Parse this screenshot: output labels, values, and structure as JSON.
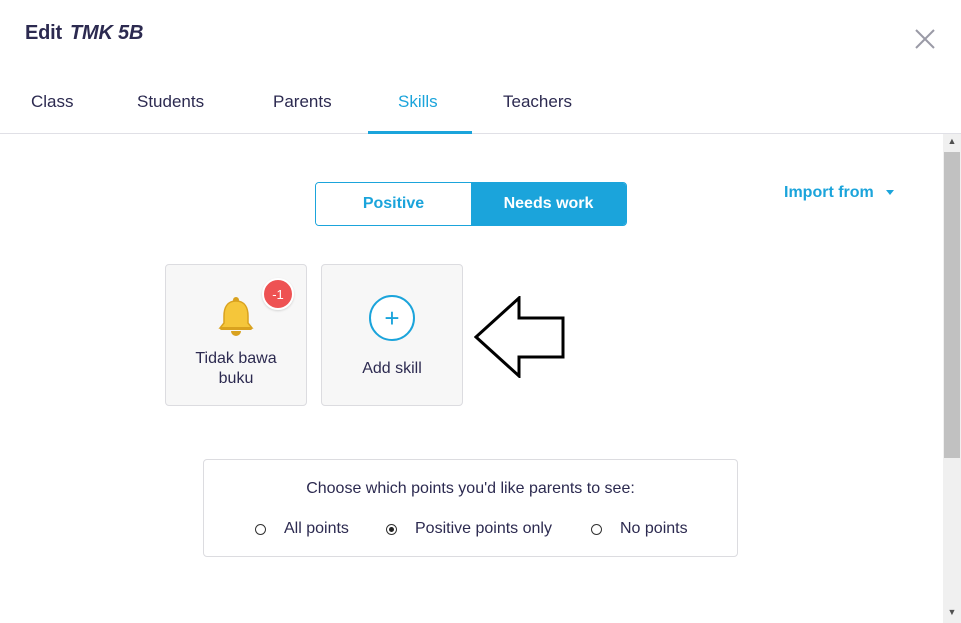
{
  "header": {
    "edit_label": "Edit",
    "class_name": "TMK 5B"
  },
  "tabs": [
    {
      "label": "Class"
    },
    {
      "label": "Students"
    },
    {
      "label": "Parents"
    },
    {
      "label": "Skills",
      "active": true
    },
    {
      "label": "Teachers"
    }
  ],
  "skill_type_toggle": {
    "positive_label": "Positive",
    "needs_work_label": "Needs work",
    "selected": "Needs work"
  },
  "import": {
    "label": "Import from"
  },
  "skills": [
    {
      "name": "Tidak bawa buku",
      "points": "-1",
      "icon": "bell-icon"
    }
  ],
  "add_skill": {
    "label": "Add skill",
    "icon": "plus-icon"
  },
  "parents_visibility": {
    "question": "Choose which points you'd like parents to see:",
    "options": [
      {
        "label": "All points",
        "checked": false
      },
      {
        "label": "Positive points only",
        "checked": true
      },
      {
        "label": "No points",
        "checked": false
      }
    ]
  },
  "colors": {
    "accent": "#1ba4db",
    "text": "#2c2a50",
    "badge": "#ee5253",
    "bell": "#f5c63a"
  }
}
